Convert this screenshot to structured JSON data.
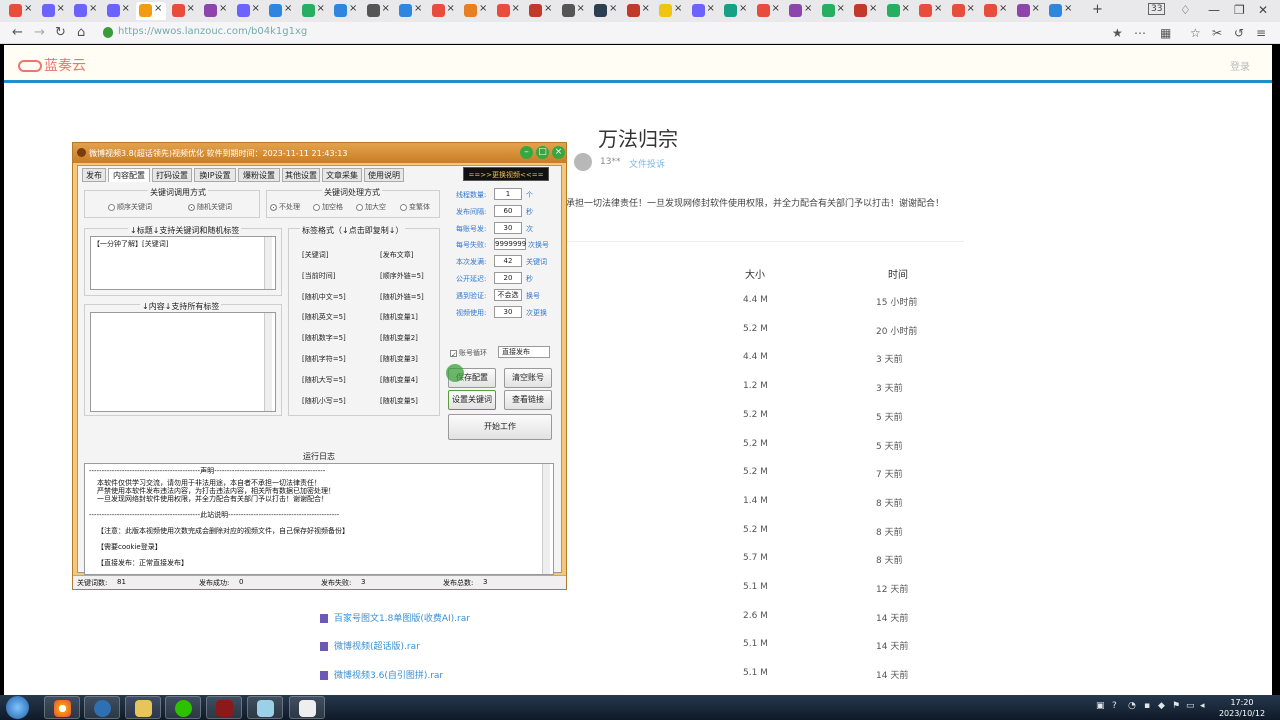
{
  "browser": {
    "tabs": [
      "tab",
      "tab",
      "tab",
      "tab",
      "tab",
      "tab",
      "tab",
      "tab",
      "tab",
      "tab",
      "tab",
      "tab",
      "tab",
      "tab",
      "tab",
      "tab",
      "tab",
      "tab",
      "tab",
      "tab",
      "tab",
      "tab",
      "tab",
      "tab",
      "tab",
      "tab",
      "tab",
      "tab",
      "tab",
      "tab",
      "tab",
      "tab",
      "tab"
    ],
    "tab_counter": "33",
    "url": "https://wwos.lanzouc.com/b04k1g1xg"
  },
  "site": {
    "logo_text": "蓝奏云",
    "login": "登录",
    "title": "万法归宗",
    "user": "13**",
    "user_link": "文件投诉",
    "notice": "承担一切法律责任！一旦发现网修封软件使用权限，并全力配合有关部门予以打击！谢谢配合！",
    "table": {
      "col_size": "大小",
      "col_time": "时间",
      "rows": [
        {
          "name": "",
          "size": "4.4 M",
          "time": "15 小时前"
        },
        {
          "name": "",
          "size": "5.2 M",
          "time": "20 小时前"
        },
        {
          "name": "",
          "size": "4.4 M",
          "time": "3 天前"
        },
        {
          "name": "",
          "size": "1.2 M",
          "time": "3 天前"
        },
        {
          "name": "",
          "size": "5.2 M",
          "time": "5 天前"
        },
        {
          "name": "",
          "size": "5.2 M",
          "time": "5 天前"
        },
        {
          "name": "",
          "size": "5.2 M",
          "time": "7 天前"
        },
        {
          "name": "",
          "size": "1.4 M",
          "time": "8 天前"
        },
        {
          "name": "",
          "size": "5.2 M",
          "time": "8 天前"
        },
        {
          "name": "",
          "size": "5.7 M",
          "time": "8 天前"
        },
        {
          "name": "",
          "size": "5.1 M",
          "time": "12 天前"
        },
        {
          "name": "百家号图文1.8单图版(收费AI).rar",
          "size": "2.6 M",
          "time": "14 天前"
        },
        {
          "name": "微博视频(超话版).rar",
          "size": "5.1 M",
          "time": "14 天前"
        },
        {
          "name": "微博视频3.6(自引图拼).rar",
          "size": "5.1 M",
          "time": "14 天前"
        }
      ]
    }
  },
  "app": {
    "title": "微博视频3.8(超话领先)视频优化      软件到期时间：2023-11-11 21:43:13",
    "switch_btn": "==>>更换视频<<==",
    "tabs": [
      "发布",
      "内容配置",
      "打码设置",
      "换IP设置",
      "爆粉设置",
      "其他设置",
      "文章采集",
      "使用说明"
    ],
    "kw_call_title": "关键词调用方式",
    "kw_call_opts": [
      "顺序关键词",
      "随机关键词"
    ],
    "kw_proc_title": "关键词处理方式",
    "kw_proc_opts": [
      "不处理",
      "加空格",
      "加大空",
      "变繁体"
    ],
    "title_label": "↓标题↓支持关键词和随机标签",
    "title_value": "【一分钟了解】[关键词]",
    "content_label": "↓内容↓支持所有标签",
    "tagfmt_label": "标签格式（↓点击即复制↓）",
    "tags_left": [
      "[关键词]",
      "[当前时间]",
      "[随机中文=5]",
      "[随机英文=5]",
      "[随机数字=5]",
      "[随机字符=5]",
      "[随机大写=5]",
      "[随机小写=5]"
    ],
    "tags_right": [
      "[发布文章]",
      "[顺序外链=5]",
      "[随机外链=5]",
      "[随机变量1]",
      "[随机变量2]",
      "[随机变量3]",
      "[随机变量4]",
      "[随机变量5]"
    ],
    "params": [
      {
        "label": "线程数量:",
        "value": "1",
        "unit": "个"
      },
      {
        "label": "发布间隔:",
        "value": "60",
        "unit": "秒"
      },
      {
        "label": "每账号发:",
        "value": "30",
        "unit": "次"
      },
      {
        "label": "每号失败:",
        "value": "9999999",
        "unit": "次换号"
      },
      {
        "label": "本次发满:",
        "value": "42",
        "unit": "关键词"
      },
      {
        "label": "公开延迟:",
        "value": "20",
        "unit": "秒"
      },
      {
        "label": "遇到验证:",
        "value": "不会选",
        "unit": "换号"
      },
      {
        "label": "视频使用:",
        "value": "30",
        "unit": "次更换"
      }
    ],
    "loop_label": "账号循环",
    "publish_mode": "直接发布",
    "btn_save": "保存配置",
    "btn_clear": "清空账号",
    "btn_kw": "设置关键词",
    "btn_links": "查看链接",
    "btn_start": "开始工作",
    "log_title": "运行日志",
    "log_lines": [
      "--------------------------------------------声明--------------------------------------------",
      "本软件仅供学习交流，请勿用于非法用途，本自者不承担一切法律责任！",
      "严禁使用本软件发布违法内容，为打击违法内容，相关所有数据已加密处理！",
      "一旦发现网络封软件使用权限，并全力配合有关部门予以打击！谢谢配合！",
      "--------------------------------------------此站说明--------------------------------------------",
      "【注意：此版本视频使用次数完成会删除对应的视频文件，自己保存好视频备份】",
      "【需要cookie登录】",
      "【直接发布：正常直接发布】"
    ],
    "status": [
      {
        "label": "关键词数:",
        "value": "81"
      },
      {
        "label": "发布成功:",
        "value": "0"
      },
      {
        "label": "发布失败:",
        "value": "3"
      },
      {
        "label": "发布总数:",
        "value": "3"
      }
    ]
  },
  "taskbar": {
    "time": "17:20",
    "date": "2023/10/12"
  }
}
